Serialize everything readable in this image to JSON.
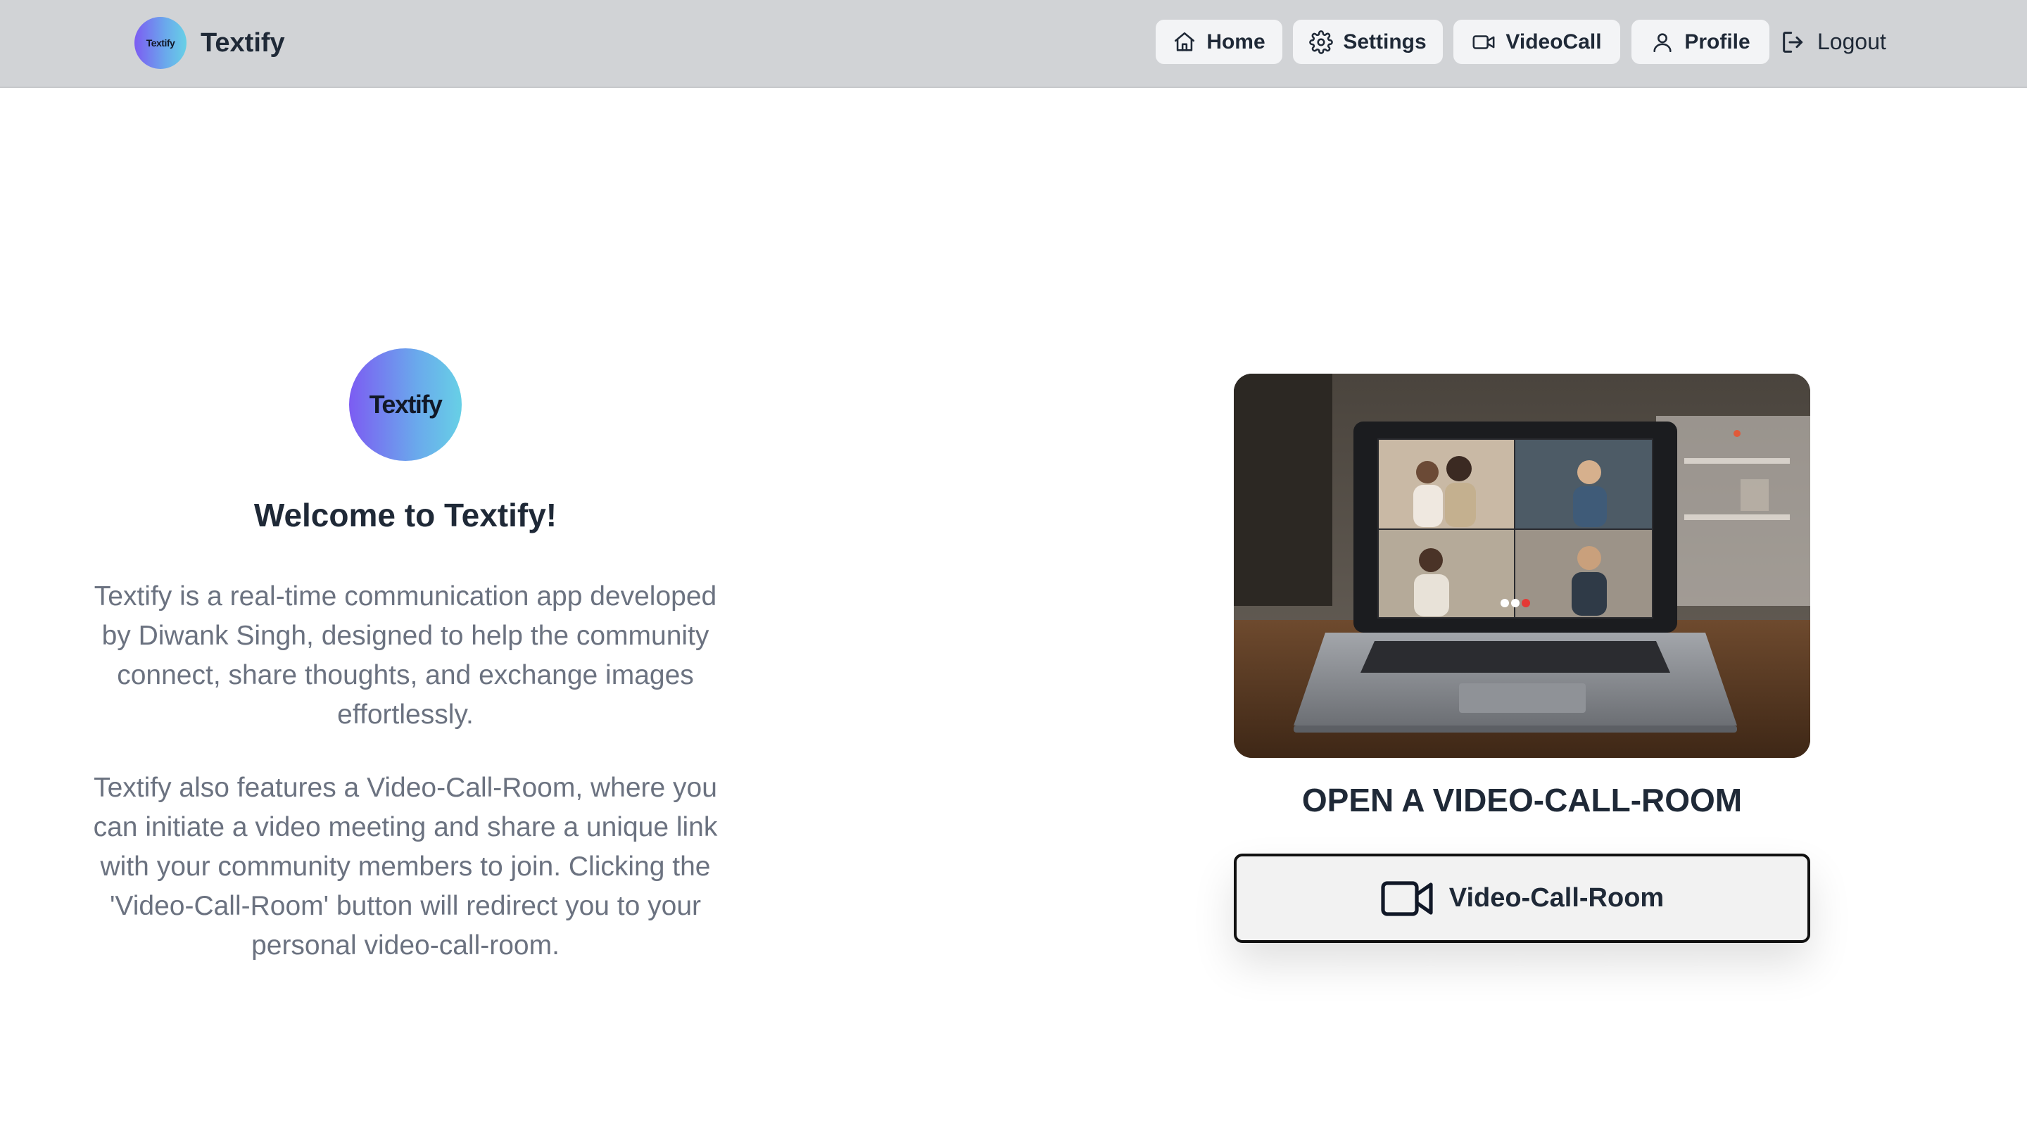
{
  "brand": {
    "logo_text": "Textify",
    "name": "Textify"
  },
  "nav": {
    "home": "Home",
    "settings": "Settings",
    "videocall": "VideoCall",
    "profile": "Profile",
    "logout": "Logout"
  },
  "hero": {
    "logo_text": "Textify",
    "title": "Welcome to Textify!",
    "paragraph1": "Textify is a real-time communication app developed by Diwank Singh, designed to help the community connect, share thoughts, and exchange images effortlessly.",
    "paragraph2": "Textify also features a Video-Call-Room, where you can initiate a video meeting and share a unique link with your community members to join. Clicking the 'Video-Call-Room' button will redirect you to your personal video-call-room."
  },
  "room": {
    "title": "OPEN A VIDEO-CALL-ROOM",
    "button_label": "Video-Call-Room"
  },
  "icons": {
    "home": "home-icon",
    "settings": "gear-icon",
    "videocall": "video-camera-icon",
    "profile": "user-icon",
    "logout": "logout-icon"
  },
  "colors": {
    "navbar_bg": "#d1d3d6",
    "nav_button_bg": "#f3f4f6",
    "logo_gradient_start": "#7c5cf2",
    "logo_gradient_end": "#67d0e6",
    "body_text": "#6b7280",
    "heading_text": "#1f2937"
  }
}
